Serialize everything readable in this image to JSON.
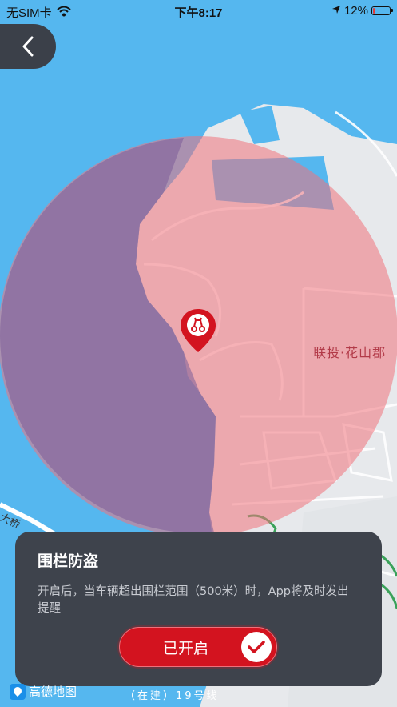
{
  "status_bar": {
    "carrier": "无SIM卡",
    "time": "下午8:17",
    "battery_percent": "12%",
    "battery_level": 0.12
  },
  "map": {
    "place_label": "联投·花山郡",
    "road_label": "大桥",
    "bottom_road_label": "（在建）19号线",
    "logo_text": "高德地图",
    "fence_color": "#f19aa1",
    "water_color": "#55b7ef"
  },
  "fence_card": {
    "title": "围栏防盗",
    "description": "开启后，当车辆超出围栏范围（500米）时，App将及时发出提醒",
    "toggle_label": "已开启",
    "toggle_on": true
  },
  "icons": {
    "back": "chevron-left-icon",
    "wifi": "wifi-icon",
    "location": "location-arrow-icon",
    "battery": "battery-icon",
    "pin": "scooter-pin-icon",
    "check": "check-icon"
  }
}
